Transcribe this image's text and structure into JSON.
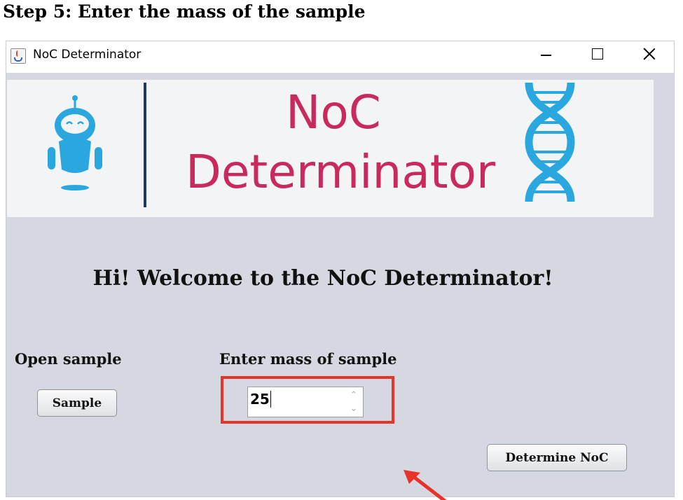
{
  "heading": "Step 5: Enter the mass of the sample",
  "window": {
    "title": "NoC Determinator",
    "controls": {
      "minimize": "minimize-icon",
      "maximize": "maximize-icon",
      "close": "close-icon"
    }
  },
  "banner": {
    "line1": "NoC",
    "line2": "Determinator",
    "robot_icon": "robot-icon",
    "dna_icon": "dna-icon",
    "colors": {
      "title": "#c82a5e",
      "icons": "#2aa7df",
      "divider": "#1d3a66"
    }
  },
  "welcome": "Hi! Welcome to the NoC Determinator!",
  "open_sample": {
    "label": "Open sample",
    "button": "Sample"
  },
  "mass": {
    "label": "Enter mass of sample",
    "value": "25"
  },
  "determine_button": "Determine NoC",
  "annotation": {
    "highlight_color": "#e8332a",
    "arrow_icon": "arrow-pointer-icon"
  }
}
